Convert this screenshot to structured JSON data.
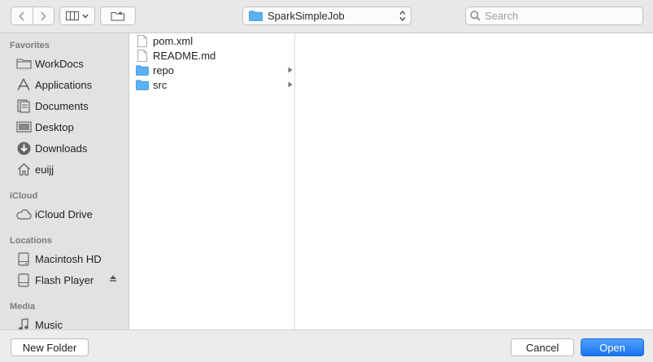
{
  "toolbar": {
    "path_popup_label": "SparkSimpleJob",
    "search_placeholder": "Search"
  },
  "sidebar": {
    "sections": [
      {
        "header": "Favorites"
      },
      {
        "header": "iCloud"
      },
      {
        "header": "Locations"
      },
      {
        "header": "Media"
      }
    ],
    "favorites": [
      {
        "label": "WorkDocs",
        "icon": "folder-icon"
      },
      {
        "label": "Applications",
        "icon": "applications-icon"
      },
      {
        "label": "Documents",
        "icon": "documents-icon"
      },
      {
        "label": "Desktop",
        "icon": "desktop-icon"
      },
      {
        "label": "Downloads",
        "icon": "downloads-icon"
      },
      {
        "label": "euijj",
        "icon": "home-icon"
      }
    ],
    "icloud": [
      {
        "label": "iCloud Drive",
        "icon": "cloud-icon"
      }
    ],
    "locations": [
      {
        "label": "Macintosh HD",
        "icon": "hard-drive-icon"
      },
      {
        "label": "Flash Player",
        "icon": "disk-icon"
      }
    ],
    "media": [
      {
        "label": "Music",
        "icon": "music-note-icon"
      }
    ]
  },
  "files": [
    {
      "name": "pom.xml",
      "type": "file"
    },
    {
      "name": "README.md",
      "type": "file"
    },
    {
      "name": "repo",
      "type": "folder"
    },
    {
      "name": "src",
      "type": "folder"
    }
  ],
  "footer": {
    "new_folder_label": "New Folder",
    "cancel_label": "Cancel",
    "open_label": "Open"
  },
  "colors": {
    "accent": "#1a73f0",
    "folder": "#5ab1f4",
    "sidebar_bg": "#e2e2e2"
  }
}
